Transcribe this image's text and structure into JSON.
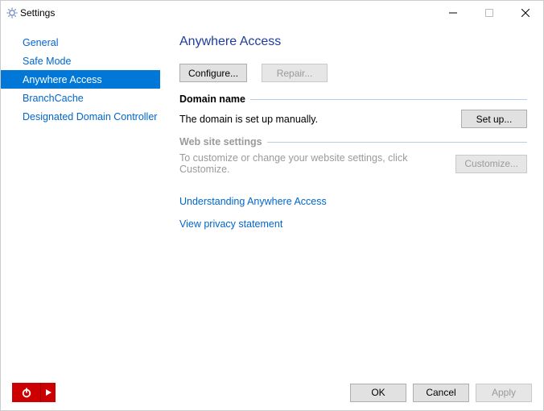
{
  "window": {
    "title": "Settings"
  },
  "sidebar": {
    "items": [
      {
        "label": "General"
      },
      {
        "label": "Safe Mode"
      },
      {
        "label": "Anywhere Access"
      },
      {
        "label": "BranchCache"
      },
      {
        "label": "Designated Domain Controller"
      }
    ],
    "selected_index": 2
  },
  "page": {
    "title": "Anywhere Access",
    "buttons": {
      "configure": "Configure...",
      "repair": "Repair..."
    },
    "sections": {
      "domain": {
        "title": "Domain name",
        "text": "The domain is set up manually.",
        "button": "Set up..."
      },
      "web": {
        "title": "Web site settings",
        "text": "To customize or change your website settings, click Customize.",
        "button": "Customize..."
      }
    },
    "links": {
      "understanding": "Understanding Anywhere Access",
      "privacy": "View privacy statement"
    }
  },
  "footer": {
    "ok": "OK",
    "cancel": "Cancel",
    "apply": "Apply"
  }
}
